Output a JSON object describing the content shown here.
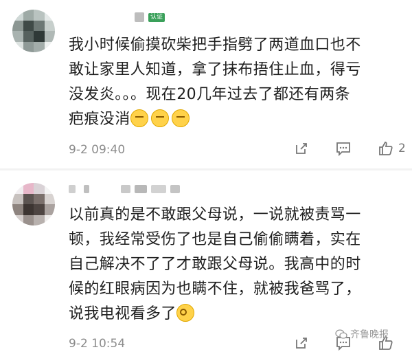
{
  "comments": [
    {
      "badge": "认证",
      "lines": [
        "我小时候偷摸砍柴把手指劈了两道血口也不",
        "敢让家里人知道，拿了抹布捂住止血，得亏",
        "没发炎。。。现在20几年过去了都还有两条",
        "疤痕没消"
      ],
      "emoji_icon": "sad-sweat-emoji",
      "time": "9-2 09:40",
      "like_count": "2"
    },
    {
      "lines": [
        "以前真的是不敢跟父母说，一说就被责骂一",
        "顿，我经常受伤了也是自己偷偷瞒着，实在",
        "自己解决不了了才敢跟父母说。我高中的时",
        "候的红眼病因为也瞒不住，就被我爸骂了，",
        "说我电视看多了"
      ],
      "emoji_icon": "eye-roll-emoji",
      "time": "9-2 10:54"
    }
  ],
  "watermark": "齐鲁晚报",
  "colors": {
    "badge": "#3aa05a",
    "meta": "#8c8c8c",
    "icon": "#777777"
  }
}
